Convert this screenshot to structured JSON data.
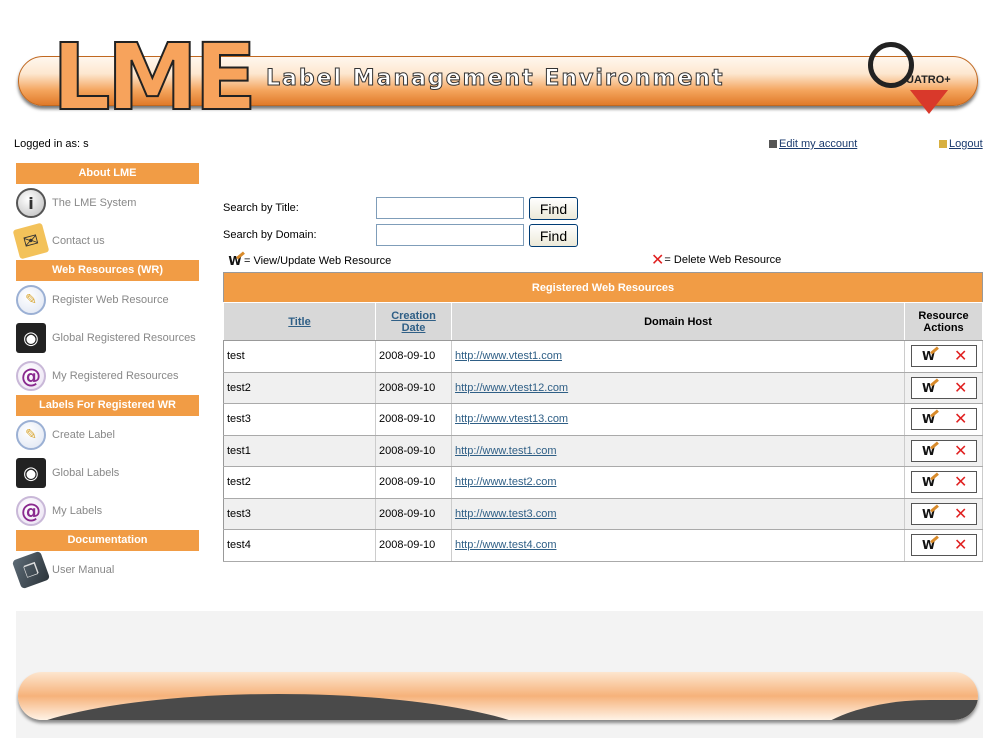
{
  "header": {
    "logo_letters": [
      "L",
      "M",
      "E"
    ],
    "title": "Label Management Environment",
    "partner_logo_text": "UATRO+"
  },
  "user": {
    "logged_in_label": "Logged in as: s",
    "edit_account": "Edit my account",
    "logout": "Logout"
  },
  "sidebar": {
    "sections": [
      {
        "title": "About LME",
        "items": [
          {
            "label": "The LME System",
            "icon": "info-icon"
          },
          {
            "label": "Contact us",
            "icon": "mail-icon"
          }
        ]
      },
      {
        "title": "Web Resources (WR)",
        "items": [
          {
            "label": "Register Web Resource",
            "icon": "document-icon"
          },
          {
            "label": "Global Registered Resources",
            "icon": "eye-icon"
          },
          {
            "label": "My Registered Resources",
            "icon": "at-icon"
          }
        ]
      },
      {
        "title": "Labels For Registered WR",
        "items": [
          {
            "label": "Create Label",
            "icon": "document-icon"
          },
          {
            "label": "Global Labels",
            "icon": "eye-icon"
          },
          {
            "label": "My Labels",
            "icon": "at-icon"
          }
        ]
      },
      {
        "title": "Documentation",
        "items": [
          {
            "label": "User Manual",
            "icon": "book-icon"
          }
        ]
      }
    ]
  },
  "search": {
    "title_label": "Search by Title:",
    "title_value": "",
    "domain_label": "Search by Domain:",
    "domain_value": "",
    "find_label": "Find"
  },
  "legend": {
    "view_update": "= View/Update Web Resource",
    "delete": "= Delete Web Resource"
  },
  "table": {
    "caption": "Registered Web Resources",
    "columns": {
      "title": "Title",
      "creation_date": "Creation Date",
      "domain_host": "Domain Host",
      "resource_actions": "Resource Actions"
    },
    "rows": [
      {
        "title": "test",
        "date": "2008-09-10",
        "host": "http://www.vtest1.com"
      },
      {
        "title": "test2",
        "date": "2008-09-10",
        "host": "http://www.vtest12.com"
      },
      {
        "title": "test3",
        "date": "2008-09-10",
        "host": "http://www.vtest13.com"
      },
      {
        "title": "test1",
        "date": "2008-09-10",
        "host": "http://www.test1.com"
      },
      {
        "title": "test2",
        "date": "2008-09-10",
        "host": "http://www.test2.com"
      },
      {
        "title": "test3",
        "date": "2008-09-10",
        "host": "http://www.test3.com"
      },
      {
        "title": "test4",
        "date": "2008-09-10",
        "host": "http://www.test4.com"
      }
    ]
  },
  "colors": {
    "accent_orange": "#f19c45",
    "link_blue": "#2f5f86",
    "delete_red": "#e02020"
  }
}
